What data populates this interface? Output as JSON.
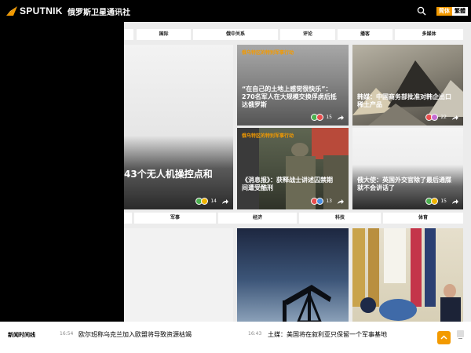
{
  "header": {
    "logo_text": "SPUTNIK",
    "site_name": "俄罗斯卫星通讯社",
    "lang_simplified": "简体",
    "lang_traditional": "繁體"
  },
  "nav_top": [
    "",
    "国际",
    "俄中关系",
    "评论",
    "播客",
    "多媒体"
  ],
  "nav_bottom": [
    "",
    "军事",
    "经济",
    "科技",
    "体育"
  ],
  "cards": {
    "big": {
      "title": "43个无人机操控点和",
      "count": "14"
    },
    "card1": {
      "tag": "俄乌特区的特别军事行动",
      "title": "“在自己的土地上感觉很快乐”：270名军人在大规模交换俘虏后抵达俄罗斯",
      "count": "15"
    },
    "card2": {
      "title": "韩媒：中国商务部批准对韩企出口稀土产品",
      "count": "22"
    },
    "card3": {
      "tag": "俄乌特区的特别军事行动",
      "title": "《消息报》：获释战士讲述囚禁期间遭受酷刑",
      "count": "13"
    },
    "card4": {
      "title": "俄大使：英国外交官除了最后通牒就不会讲话了",
      "count": "15"
    }
  },
  "footer": {
    "title": "新闻时间线",
    "items": [
      {
        "time": "16:54",
        "text": "欧尔班称乌克兰加入欧盟将导致资源枯竭"
      },
      {
        "time": "16:43",
        "text": "土媒：美国将在叙利亚只保留一个军事基地"
      }
    ]
  },
  "colors": {
    "accent": "#f39a00",
    "header_bg": "#000000"
  }
}
